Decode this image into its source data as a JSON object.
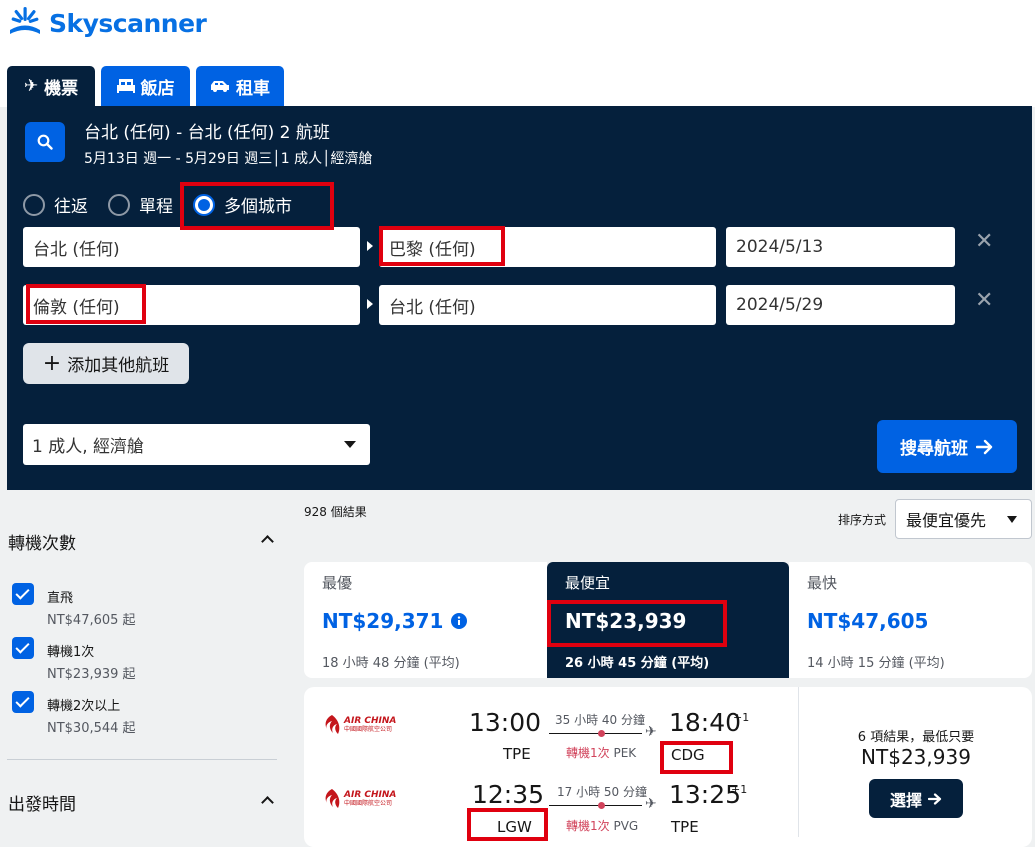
{
  "brand": {
    "name": "Skyscanner"
  },
  "tabs": [
    {
      "label": "機票",
      "icon": "plane-icon",
      "active": true
    },
    {
      "label": "飯店",
      "icon": "bed-icon",
      "active": false
    },
    {
      "label": "租車",
      "icon": "car-icon",
      "active": false
    }
  ],
  "summary": {
    "title": "台北 (任何) - 台北 (任何) 2 航班",
    "details": "5月13日 週一 - 5月29日 週三│1 成人│經濟艙"
  },
  "trip_types": [
    {
      "label": "往返",
      "selected": false
    },
    {
      "label": "單程",
      "selected": false
    },
    {
      "label": "多個城市",
      "selected": true
    }
  ],
  "legs": [
    {
      "from": "台北 (任何)",
      "to": "巴黎 (任何)",
      "date": "2024/5/13"
    },
    {
      "from": "倫敦 (任何)",
      "to": "台北 (任何)",
      "date": "2024/5/29"
    }
  ],
  "add_leg_label": "添加其他航班",
  "passengers": "1 成人, 經濟艙",
  "search_button": "搜尋航班",
  "filters": {
    "stops": {
      "title": "轉機次數",
      "options": [
        {
          "label": "直飛",
          "price": "NT$47,605 起",
          "checked": true
        },
        {
          "label": "轉機1次",
          "price": "NT$23,939 起",
          "checked": true
        },
        {
          "label": "轉機2次以上",
          "price": "NT$30,544 起",
          "checked": true
        }
      ]
    },
    "departure": {
      "title": "出發時間"
    }
  },
  "results": {
    "count": "928 個結果",
    "sort_label": "排序方式",
    "sort_value": "最便宜優先"
  },
  "sort_tabs": [
    {
      "label": "最優",
      "price": "NT$29,371",
      "duration": "18 小時 48 分鐘 (平均)",
      "active": false
    },
    {
      "label": "最便宜",
      "price": "NT$23,939",
      "duration": "26 小時 45 分鐘 (平均)",
      "active": true
    },
    {
      "label": "最快",
      "price": "NT$47,605",
      "duration": "14 小時 15 分鐘 (平均)",
      "active": false
    }
  ],
  "flight": {
    "airline": "AIR CHINA",
    "airline_cn": "中國國際航空公司",
    "legs": [
      {
        "dep_time": "13:00",
        "dep_code": "TPE",
        "duration": "35 小時 40 分鐘",
        "stops": "轉機1次",
        "via": "PEK",
        "arr_time": "18:40",
        "arr_offset": "+1",
        "arr_code": "CDG"
      },
      {
        "dep_time": "12:35",
        "dep_code": "LGW",
        "duration": "17 小時 50 分鐘",
        "stops": "轉機1次",
        "via": "PVG",
        "arr_time": "13:25",
        "arr_offset": "+1",
        "arr_code": "TPE"
      }
    ],
    "deals_text": "6 項結果，最低只要",
    "deal_price": "NT$23,939",
    "select_label": "選擇"
  },
  "colors": {
    "navy": "#05203c",
    "blue": "#0062e3",
    "annotation": "#e0000f",
    "stop_red": "#d1435b"
  }
}
